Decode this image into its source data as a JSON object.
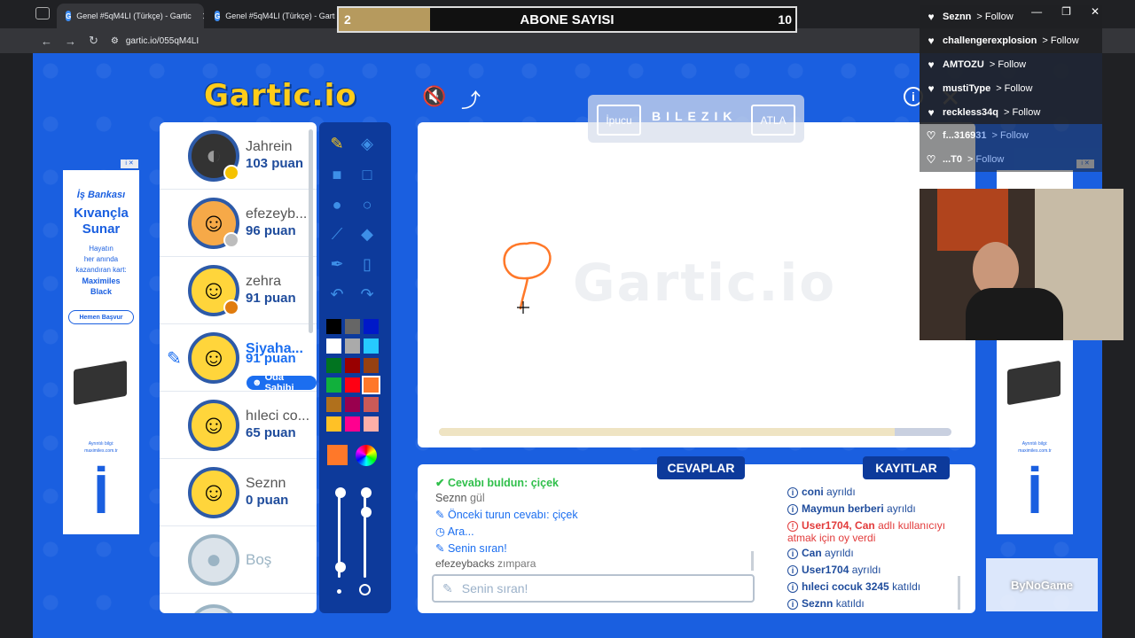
{
  "browser": {
    "tabs": [
      {
        "title": "Genel #5qM4LI (Türkçe) - Gartic"
      },
      {
        "title": "Genel #5qM4LI (Türkçe) - Gartic"
      }
    ],
    "url": "gartic.io/055qM4LI",
    "favicon_letter": "G"
  },
  "subscriber_bar": {
    "left_value": "2",
    "title": "ABONE SAYISI",
    "right_value": "10",
    "progress": 0.2
  },
  "follows": [
    {
      "name": "Seznn",
      "action": "> Follow"
    },
    {
      "name": "challengerexplosion",
      "action": "> Follow"
    },
    {
      "name": "AMTOZU",
      "action": "> Follow"
    },
    {
      "name": "mustiType",
      "action": "> Follow"
    },
    {
      "name": "reckless34q",
      "action": "> Follow"
    },
    {
      "name": "f...316931",
      "action": "> Follow"
    },
    {
      "name": "...T0",
      "action": "> Follow"
    }
  ],
  "game": {
    "logo": "Gartic.io",
    "players": [
      {
        "name": "Jahrein",
        "points": "103 puan"
      },
      {
        "name": "efezeyb...",
        "points": "96 puan"
      },
      {
        "name": "zehra",
        "points": "91 puan"
      },
      {
        "name": "Siyaha...",
        "points": "91 puan",
        "badge": "Oda Sahibi"
      },
      {
        "name": "hıleci co...",
        "points": "65 puan"
      },
      {
        "name": "Seznn",
        "points": "0 puan"
      },
      {
        "name": "Boş",
        "points": ""
      }
    ],
    "palette": [
      "#000000",
      "#666666",
      "#0019c8",
      "#ffffff",
      "#aaaaaa",
      "#26c9ff",
      "#017420",
      "#990000",
      "#964112",
      "#11b03c",
      "#ff0013",
      "#ff7829",
      "#b0701c",
      "#99004e",
      "#cb5a57",
      "#ffc126",
      "#ff008f",
      "#feafa8"
    ],
    "current_color": "#ff7829",
    "hint": {
      "hint_label": "İpucu",
      "word": "BILEZIK",
      "skip_label": "ATLA"
    },
    "canvas_watermark": "Gartic.io",
    "timer_progress": 0.89,
    "answers_tab": "CEVAPLAR",
    "logs_tab": "KAYITLAR",
    "answers": [
      {
        "user": "",
        "text": "Cevabı buldun: çiçek"
      },
      {
        "user": "Seznn",
        "text": "gül"
      },
      {
        "user": "",
        "text": "Önceki turun cevabı: çiçek"
      },
      {
        "user": "",
        "text": "Ara..."
      },
      {
        "user": "",
        "text": "Senin sıran!"
      },
      {
        "user": "efezeybacks",
        "text": "zımpara"
      }
    ],
    "answer_input_placeholder": "Senin sıran!",
    "logs": [
      {
        "user": "coni",
        "text": "ayrıldı"
      },
      {
        "user": "Maymun berberi",
        "text": "ayrıldı"
      },
      {
        "user": "User1704, Can",
        "text": "adlı kullanıcıyı atmak için oy verdi",
        "cont": "atmak için oy verdi"
      },
      {
        "user": "Can",
        "text": "ayrıldı"
      },
      {
        "user": "User1704",
        "text": "ayrıldı"
      },
      {
        "user": "hıleci cocuk 3245",
        "text": "katıldı"
      },
      {
        "user": "Seznn",
        "text": "katıldı"
      }
    ]
  },
  "ad": {
    "brand_top": "İş Bankası",
    "headline_1": "Kıvançla",
    "headline_2": "Sunar",
    "body_1": "Hayatın",
    "body_2": "her anında",
    "body_3": "kazandıran kart:",
    "body_4": "Maximiles",
    "body_5": "Black",
    "cta": "Hemen Başvur",
    "footer_1": "Ayrıntılı bilgi:",
    "footer_2": "maximiles.com.tr",
    "tag": "i ✕"
  },
  "overlay_brand": "ByNoGame"
}
